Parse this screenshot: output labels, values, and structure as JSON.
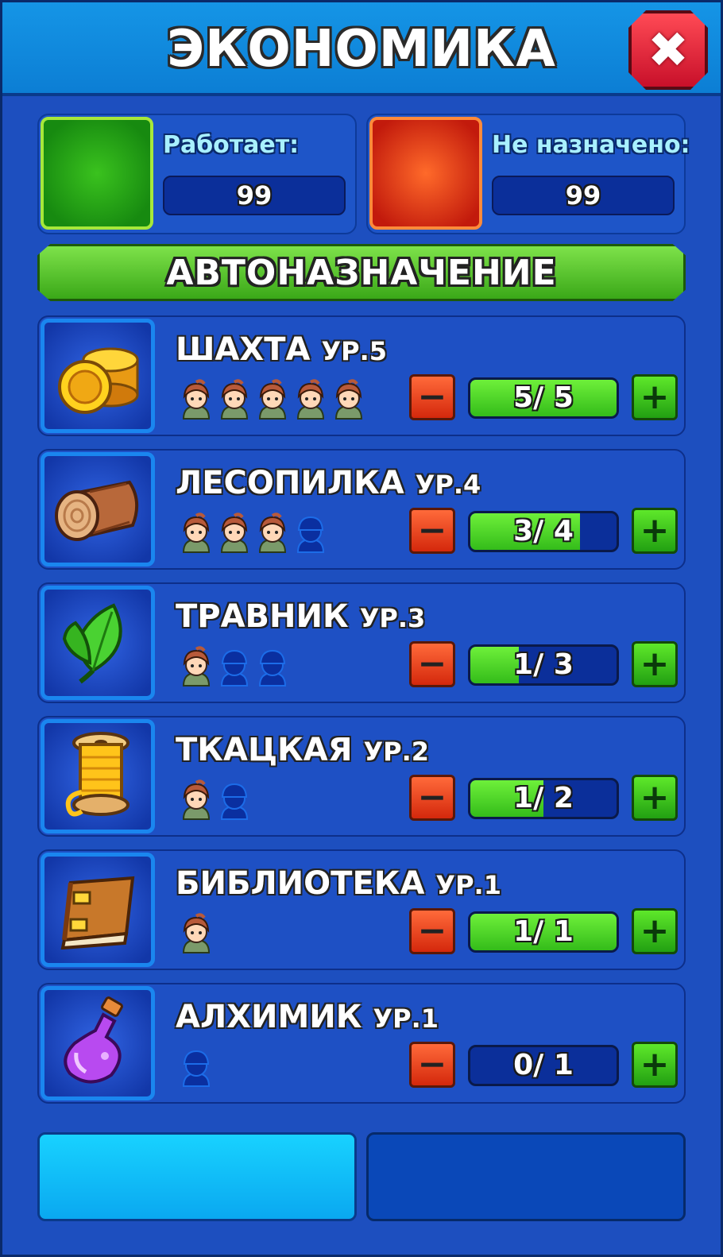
{
  "header": {
    "title": "ЭКОНОМИКА",
    "close_icon": "close-icon"
  },
  "stats": {
    "working": {
      "label": "Работает:",
      "value": "99",
      "color": "#22a012"
    },
    "unassigned": {
      "label": "Не назначено:",
      "value": "99",
      "color": "#e0320c"
    }
  },
  "auto_assign": {
    "label": "АВТОНАЗНАЧЕНИЕ"
  },
  "buildings": [
    {
      "name": "ШАХТА",
      "level": "УР.5",
      "icon": "coins-icon",
      "assigned": 5,
      "capacity": 5,
      "count_text": "5/ 5"
    },
    {
      "name": "ЛЕСОПИЛКА",
      "level": "УР.4",
      "icon": "log-icon",
      "assigned": 3,
      "capacity": 4,
      "count_text": "3/ 4"
    },
    {
      "name": "ТРАВНИК",
      "level": "УР.3",
      "icon": "leaf-icon",
      "assigned": 1,
      "capacity": 3,
      "count_text": "1/ 3"
    },
    {
      "name": "ТКАЦКАЯ",
      "level": "УР.2",
      "icon": "spool-icon",
      "assigned": 1,
      "capacity": 2,
      "count_text": "1/ 2"
    },
    {
      "name": "БИБЛИОТЕКА",
      "level": "УР.1",
      "icon": "book-icon",
      "assigned": 1,
      "capacity": 1,
      "count_text": "1/ 1"
    },
    {
      "name": "АЛХИМИК",
      "level": "УР.1",
      "icon": "potion-icon",
      "assigned": 0,
      "capacity": 1,
      "count_text": "0/ 1"
    }
  ],
  "controls": {
    "minus": "−",
    "plus": "+"
  }
}
